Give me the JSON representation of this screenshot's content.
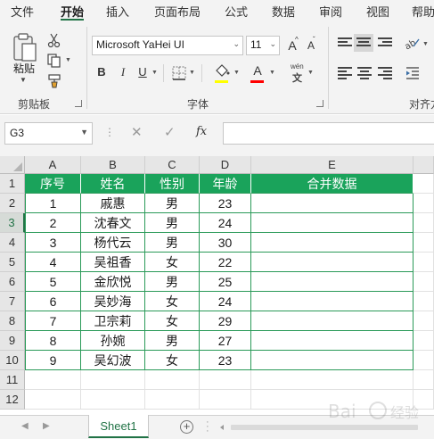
{
  "ribbon": {
    "tabs": [
      "文件",
      "开始",
      "插入",
      "页面布局",
      "公式",
      "数据",
      "审阅",
      "视图",
      "帮助"
    ],
    "active_tab": "开始",
    "clipboard": {
      "paste_label": "粘贴",
      "group_label": "剪贴板"
    },
    "font": {
      "font_name": "Microsoft YaHei UI",
      "font_size": "11",
      "bold": "B",
      "italic": "I",
      "underline": "U",
      "grow_font": "A",
      "shrink_font": "A",
      "font_color_letter": "A",
      "phonetic": "wén",
      "group_label": "字体"
    },
    "alignment": {
      "group_label": "对齐方"
    }
  },
  "formula_bar": {
    "name_box": "G3",
    "cancel": "✕",
    "enter": "✓",
    "fx": "fx",
    "formula": ""
  },
  "sheet": {
    "columns": [
      "A",
      "B",
      "C",
      "D",
      "E"
    ],
    "rows": [
      "1",
      "2",
      "3",
      "4",
      "5",
      "6",
      "7",
      "8",
      "9",
      "10",
      "11",
      "12"
    ],
    "header": [
      "序号",
      "姓名",
      "性别",
      "年龄",
      "合并数据"
    ],
    "data": [
      [
        "1",
        "戚惠",
        "男",
        "23",
        ""
      ],
      [
        "2",
        "沈春文",
        "男",
        "24",
        ""
      ],
      [
        "3",
        "杨代云",
        "男",
        "30",
        ""
      ],
      [
        "4",
        "吴祖香",
        "女",
        "22",
        ""
      ],
      [
        "5",
        "金欣悦",
        "男",
        "25",
        ""
      ],
      [
        "6",
        "吴妙海",
        "女",
        "24",
        ""
      ],
      [
        "7",
        "卫宗莉",
        "女",
        "29",
        ""
      ],
      [
        "8",
        "孙婉",
        "男",
        "27",
        ""
      ],
      [
        "9",
        "吴幻波",
        "女",
        "23",
        ""
      ]
    ],
    "selected_row": "3",
    "header_color": "#1aa35b",
    "border_color": "#2a9a58"
  },
  "sheet_tabs": {
    "tabs": [
      "Sheet1"
    ],
    "add": "+"
  },
  "colors": {
    "accent": "#217346",
    "font_highlight": "#ffff00",
    "font_color": "#ff0000"
  }
}
